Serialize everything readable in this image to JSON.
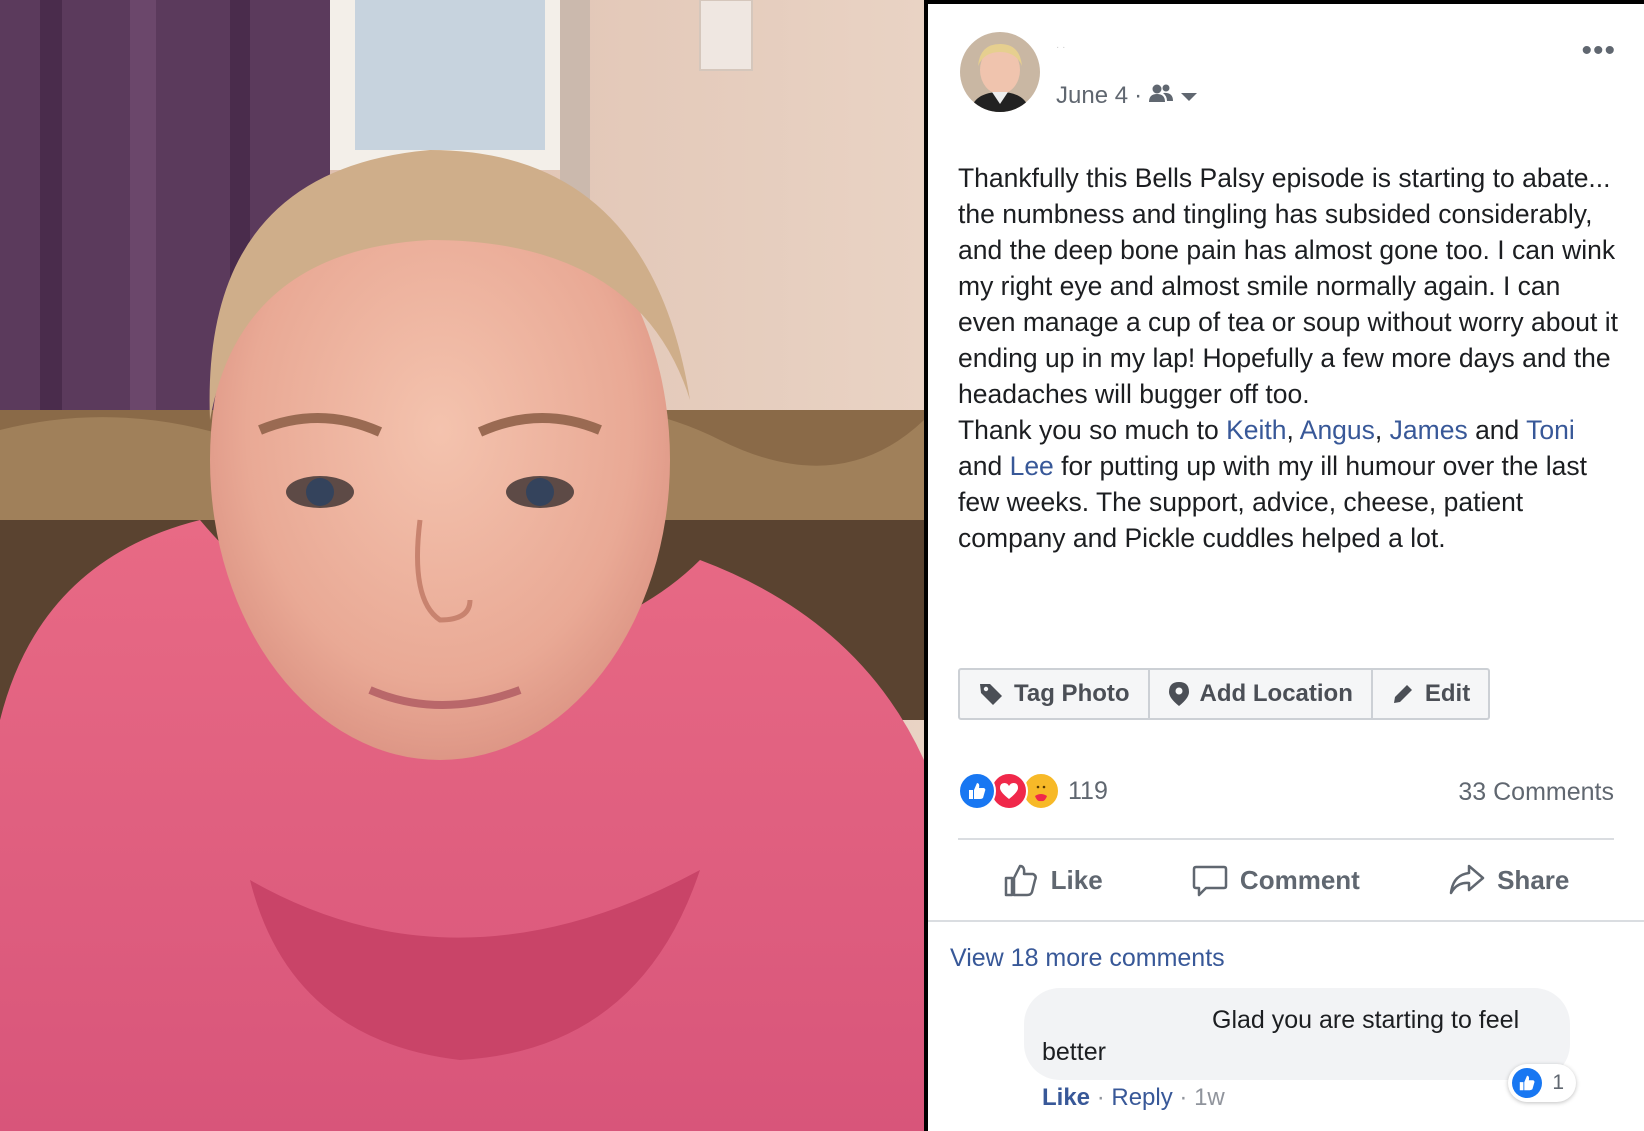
{
  "post": {
    "date": "June 4",
    "privacy_icon": "friends-icon",
    "text_parts": [
      "Thankfully this Bells Palsy episode is starting to abate... the numbness and tingling has subsided considerably, and the deep bone pain has almost gone too. I can wink my right eye and almost smile normally again. I can even manage a cup of tea or soup without worry about it ending up in my lap! Hopefully a few more days and the headaches will bugger off too.\nThank you so much to ",
      "Keith",
      ", ",
      "Angus",
      ", ",
      "James",
      " and ",
      "Toni",
      " and ",
      "Lee",
      " for putting up with my ill humour over the last few weeks. The support, advice, cheese, patient company and Pickle cuddles helped a lot."
    ]
  },
  "photo_actions": {
    "tag": "Tag Photo",
    "location": "Add Location",
    "edit": "Edit"
  },
  "stats": {
    "reaction_count": "119",
    "reactions": [
      "like",
      "love",
      "care"
    ],
    "comments": "33 Comments"
  },
  "buttons": {
    "like": "Like",
    "comment": "Comment",
    "share": "Share"
  },
  "comments": {
    "view_more": "View 18 more comments",
    "items": [
      {
        "text": "Glad you are starting to feel better",
        "like_count": "1",
        "like_action": "Like",
        "reply_action": "Reply",
        "time": "1w"
      }
    ]
  },
  "colors": {
    "link": "#385898",
    "like_blue": "#1877f2",
    "love_red": "#f0284a",
    "care_yellow": "#f7b928"
  }
}
